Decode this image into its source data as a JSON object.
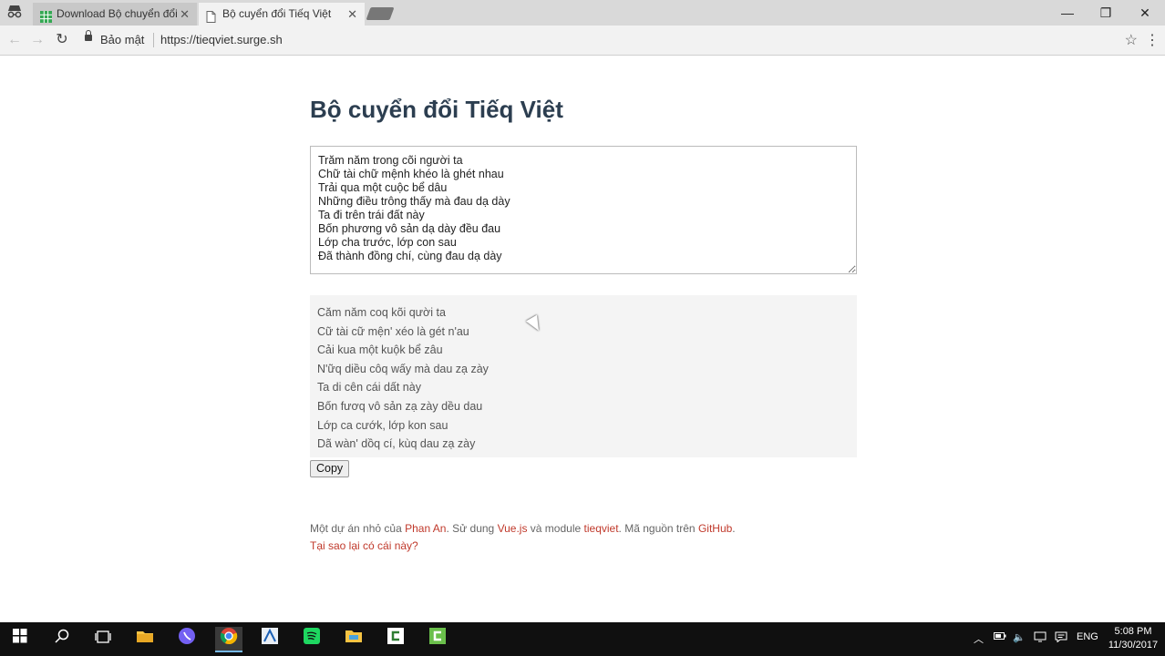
{
  "browser": {
    "tabs": [
      {
        "label": "Download Bộ chuyển đổi",
        "active": false
      },
      {
        "label": "Bộ cuyển đổi Tiếq Việt",
        "active": true
      }
    ],
    "security_label": "Bảo mật",
    "url": "https://tieqviet.surge.sh"
  },
  "page": {
    "title": "Bộ cuyển đổi Tiếq Việt",
    "input_text": "Trăm năm trong cõi người ta\nChữ tài chữ mệnh khéo là ghét nhau\nTrải qua một cuộc bể dâu\nNhững điều trông thấy mà đau dạ dày\nTa đi trên trái đất này\nBốn phương vô sản dạ dày đều đau\nLớp cha trước, lớp con sau\nĐã thành đồng chí, cùng đau dạ dày",
    "output_lines": [
      "Căm năm coq kõi qười ta",
      "Cữ tài cữ mện' xéo là gét n'au",
      "Cải kua một kuộk bể zâu",
      "N'ữq diều côq wấy mà dau zạ zày",
      "Ta di cên cái dất này",
      "Bốn fươq vô sản zạ zày dều dau",
      "Lớp ca cướk, lớp kon sau",
      "Dã wàn' dồq cí, kùq dau zạ zày"
    ],
    "copy_label": "Copy",
    "footer": {
      "t1": "Một dự án nhỏ của ",
      "author": "Phan An",
      "t2": ". Sử dung ",
      "vue": "Vue.js",
      "t3": " và module ",
      "module": "tieqviet",
      "t4": ". Mã nguồn trên ",
      "github": "GitHub",
      "t5": ".",
      "why": "Tại sao lại có cái này?"
    }
  },
  "taskbar": {
    "lang": "ENG",
    "time": "5:08 PM",
    "date": "11/30/2017"
  }
}
